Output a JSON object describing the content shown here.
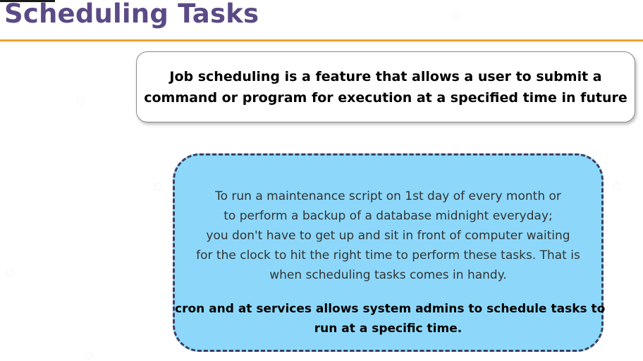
{
  "slide": {
    "title": "Scheduling Tasks",
    "definition": {
      "lines": [
        "Job scheduling is a feature that allows a user to submit a",
        "command or program for execution at a specified time in future"
      ]
    },
    "example": {
      "lines": [
        "To run a maintenance script on 1st day of every month or",
        "to perform a backup of a database midnight everyday;",
        "you don't have to get up and sit in front of computer waiting",
        "for the clock to hit the right time to perform these tasks. That is",
        "when scheduling tasks comes in handy."
      ],
      "summary_lines": [
        "cron and at services allows system admins to schedule tasks to",
        "run at a specific time."
      ]
    }
  },
  "colors": {
    "title": "#5b4a86",
    "title_rule": "#f0a030",
    "example_fill": "#8dd8fa",
    "example_border": "#3f3f5f"
  }
}
